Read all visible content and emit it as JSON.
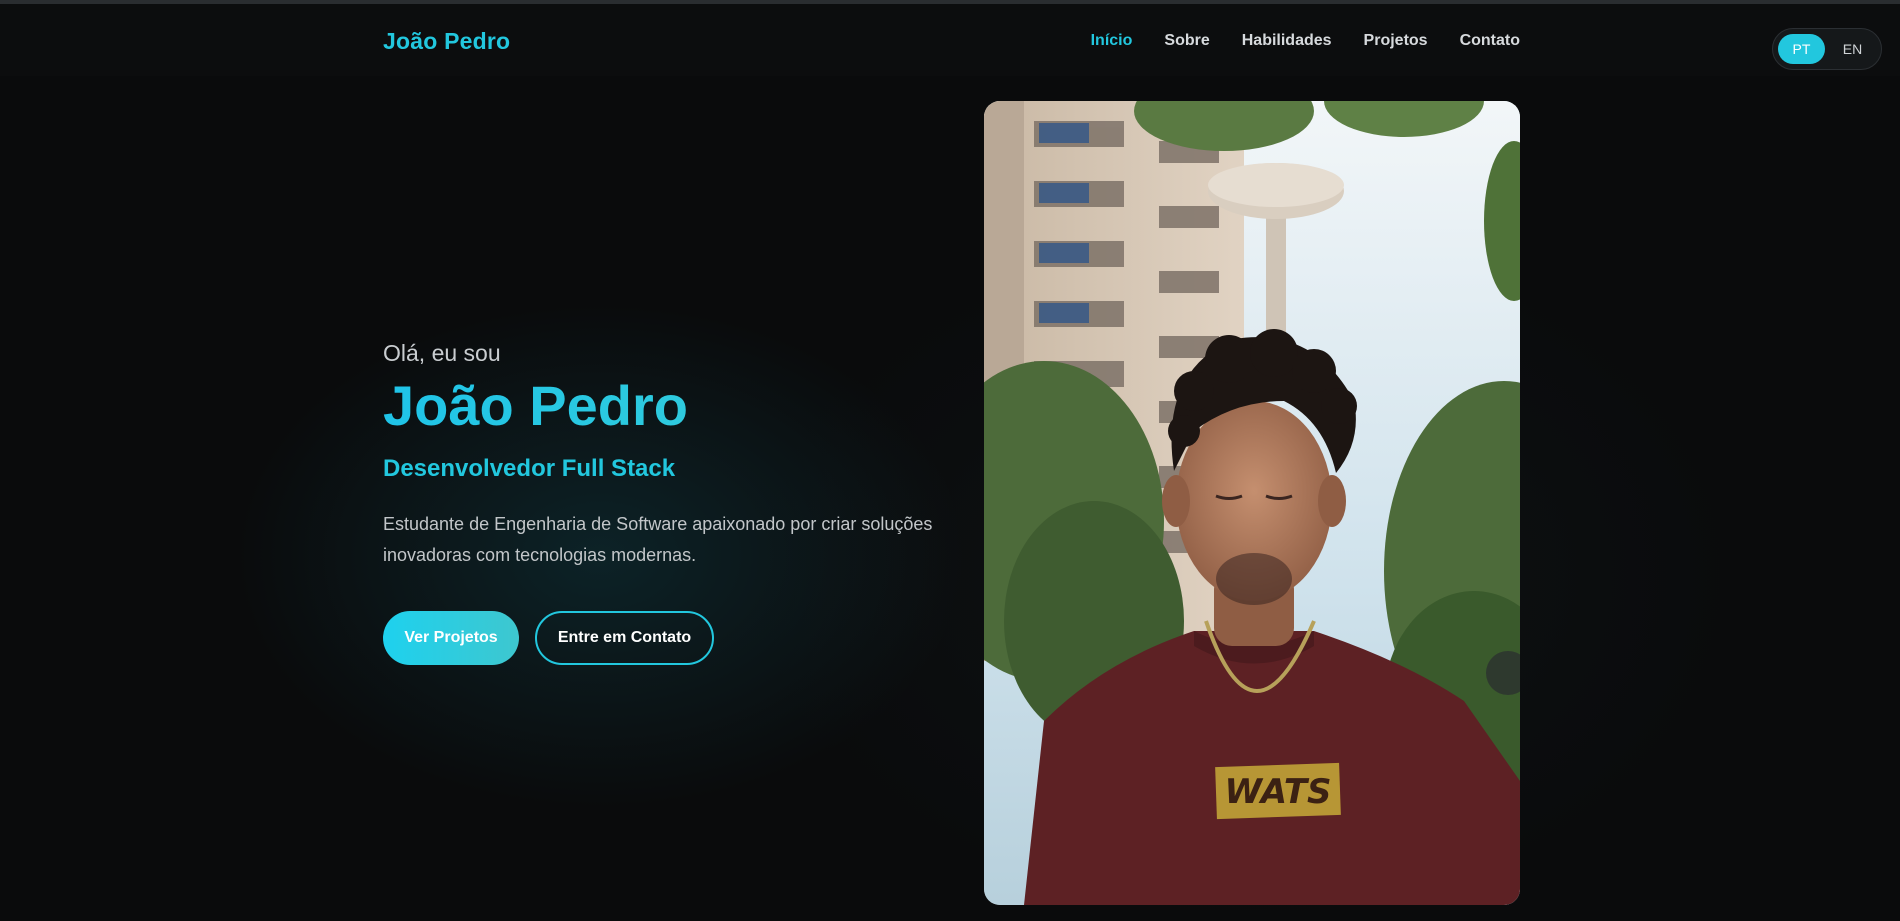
{
  "header": {
    "logo": "João Pedro",
    "nav": [
      {
        "label": "Início",
        "active": true
      },
      {
        "label": "Sobre",
        "active": false
      },
      {
        "label": "Habilidades",
        "active": false
      },
      {
        "label": "Projetos",
        "active": false
      },
      {
        "label": "Contato",
        "active": false
      }
    ],
    "language": {
      "options": [
        "PT",
        "EN"
      ],
      "selected": "PT"
    }
  },
  "hero": {
    "greeting": "Olá, eu sou",
    "name": "João Pedro",
    "role": "Desenvolvedor Full Stack",
    "description": "Estudante de Engenharia de Software apaixonado por criar soluções inovadoras com tecnologias modernas.",
    "primary_button": "Ver Projetos",
    "secondary_button": "Entre em Contato"
  },
  "photo": {
    "shirt_text": "WATS"
  },
  "colors": {
    "accent": "#22c7de",
    "background": "#0a0b0c"
  }
}
